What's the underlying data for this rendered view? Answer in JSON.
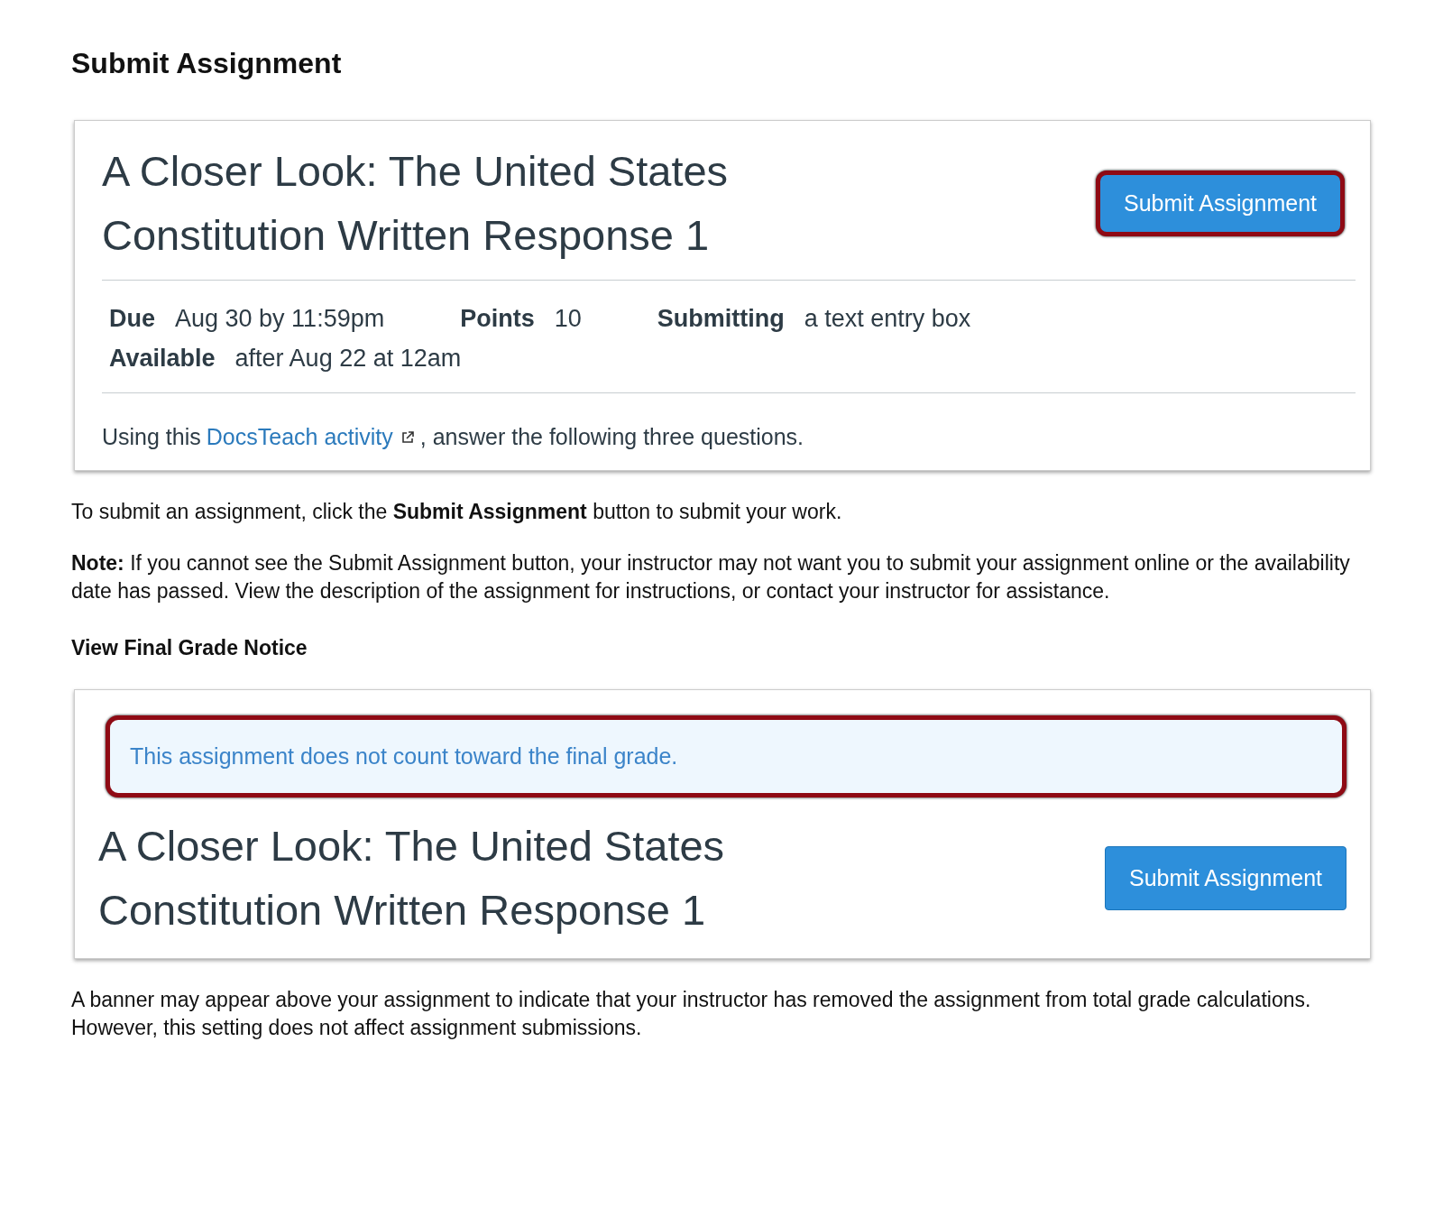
{
  "heading": "Submit Assignment",
  "example_1": {
    "title_lines": [
      "A Closer Look: The United States",
      "Constitution Written Response 1"
    ],
    "button": {
      "label": "Submit Assignment",
      "highlighted": true
    },
    "details": [
      {
        "label": "Due",
        "value": "Aug 30 by 11:59pm"
      },
      {
        "label": "Points",
        "value": "10"
      },
      {
        "label": "Submitting",
        "value": "a text entry box"
      }
    ],
    "availability": {
      "label": "Available",
      "value": "after Aug 22 at 12am"
    },
    "description": {
      "before": "Using this",
      "link": "DocsTeach activity",
      "after": ", answer the following three questions."
    }
  },
  "paragraphs_1": [
    "To submit an assignment, click the **Submit Assignment** button to submit your work.",
    "**Note:** If you cannot see the Submit Assignment button, your instructor may not want you to submit your assignment online or the availability date has passed. View the description of the assignment for instructions, or contact your instructor for assistance."
  ],
  "subheading": "View Final Grade Notice",
  "example_2": {
    "banner": {
      "text": "This assignment does not count toward the final grade.",
      "highlighted": true
    },
    "title_lines": [
      "A Closer Look: The United States",
      "Constitution Written Response 1"
    ],
    "button": {
      "label": "Submit Assignment",
      "highlighted": false
    }
  },
  "paragraphs_2": [
    "A banner may appear above your assignment to indicate that your instructor has removed the assignment from total grade calculations. However, this setting does not affect assignment submissions."
  ]
}
